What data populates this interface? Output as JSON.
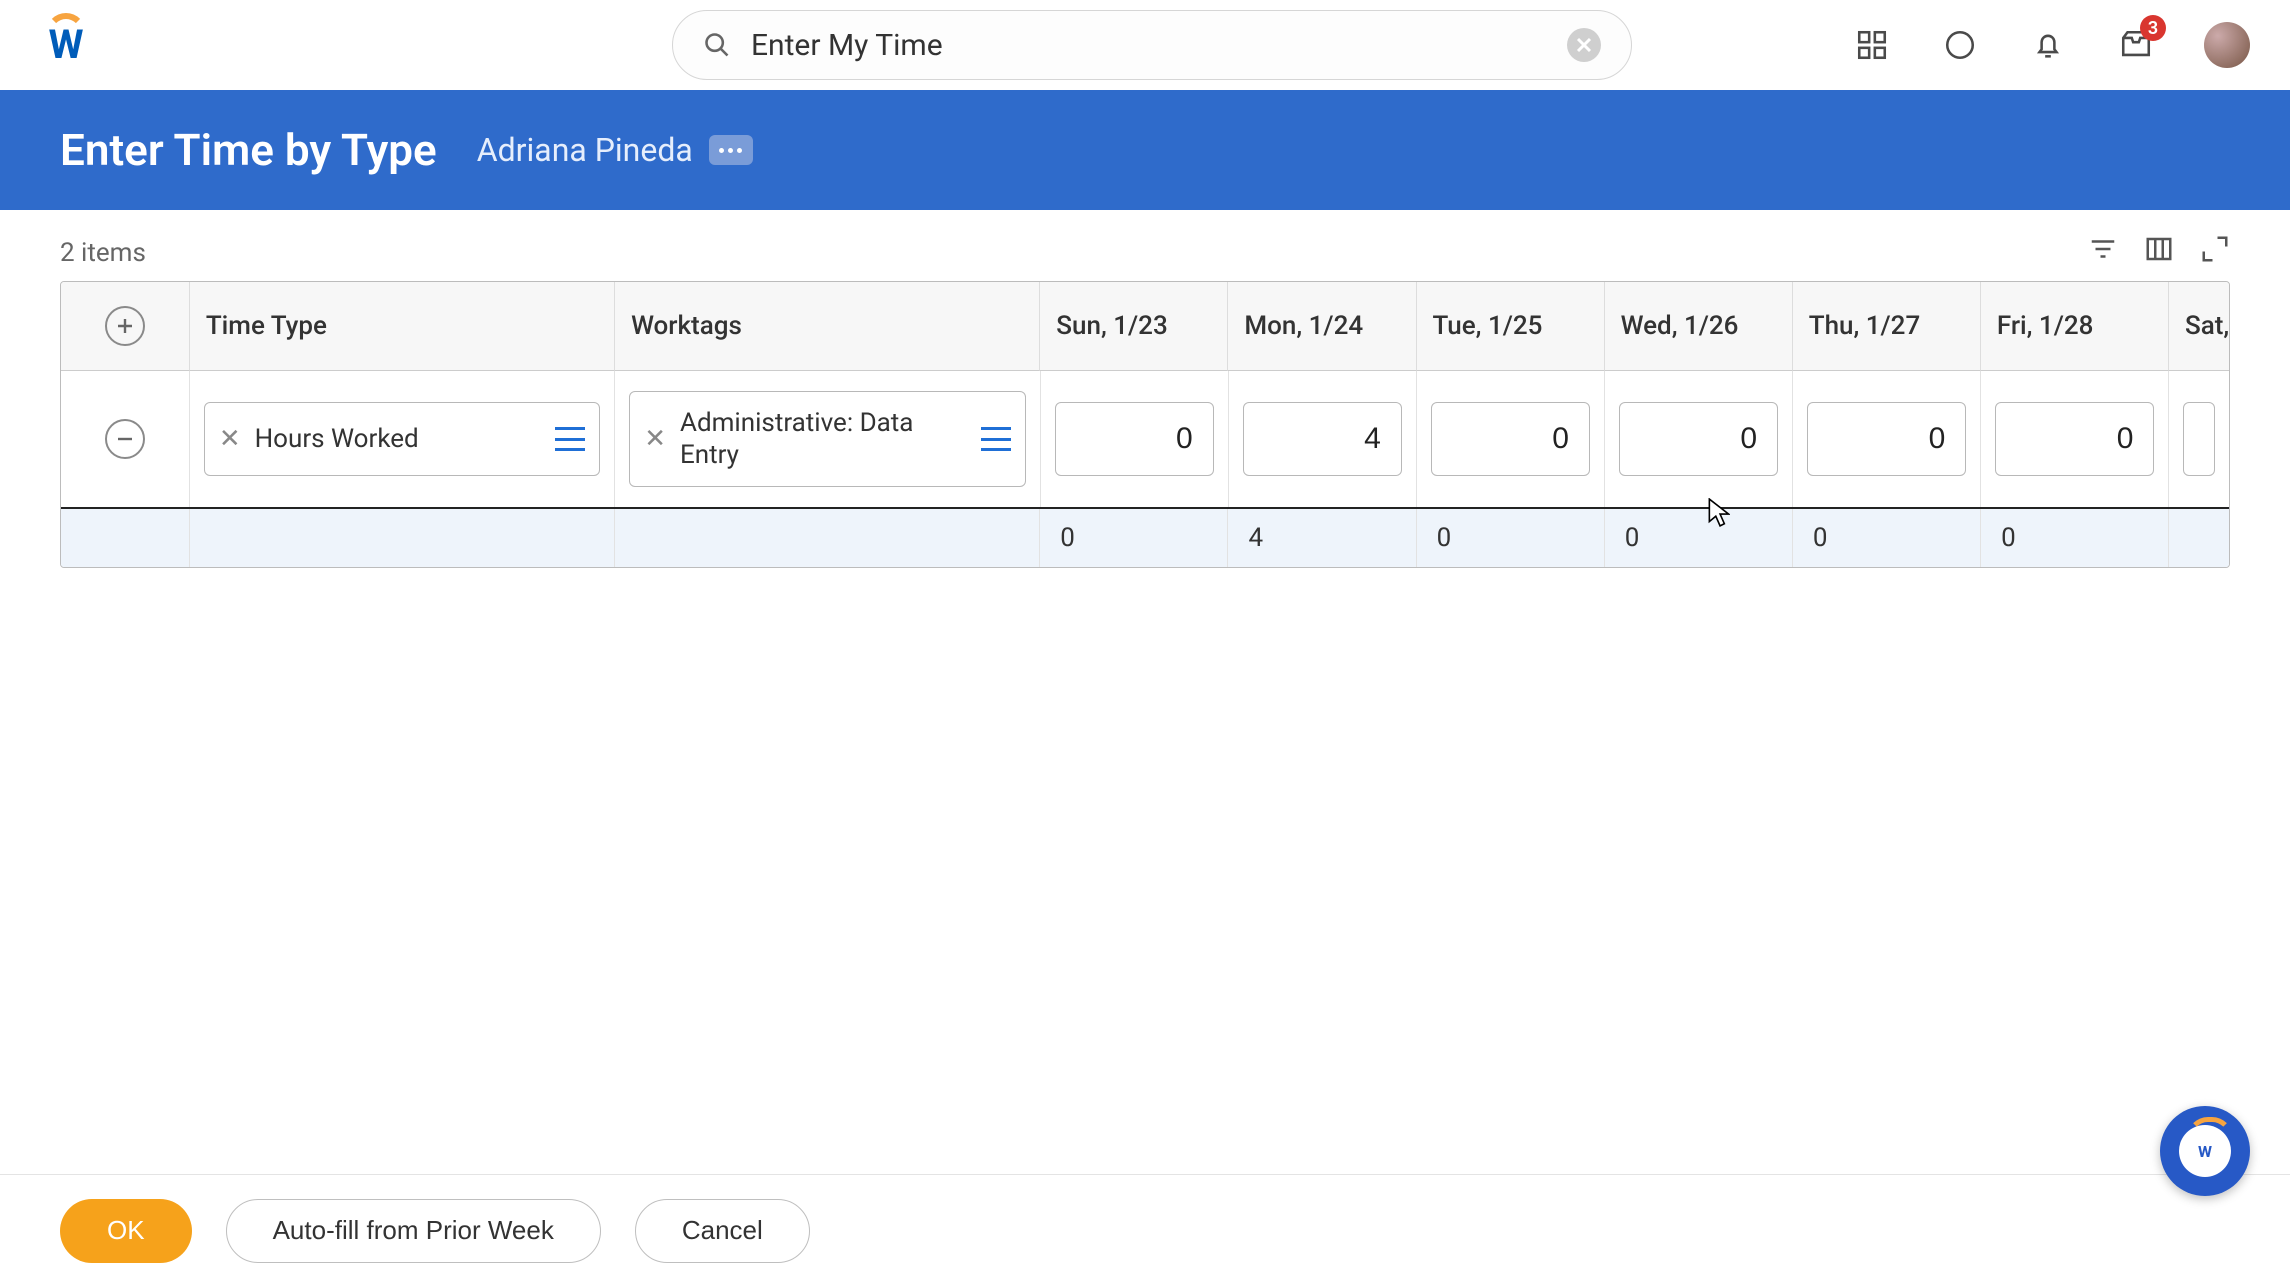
{
  "search": {
    "text": "Enter My Time"
  },
  "inbox_badge": "3",
  "header": {
    "title": "Enter Time by Type",
    "user": "Adriana Pineda"
  },
  "grid": {
    "items_label": "2 items",
    "columns": {
      "time_type": "Time Type",
      "worktags": "Worktags",
      "d0": "Sun, 1/23",
      "d1": "Mon, 1/24",
      "d2": "Tue, 1/25",
      "d3": "Wed, 1/26",
      "d4": "Thu, 1/27",
      "d5": "Fri, 1/28",
      "d6": "Sat,"
    },
    "row": {
      "time_type": "Hours Worked",
      "worktag": "Administrative: Data Entry",
      "d0": "0",
      "d1": "4",
      "d2": "0",
      "d3": "0",
      "d4": "0",
      "d5": "0"
    },
    "totals": {
      "d0": "0",
      "d1": "4",
      "d2": "0",
      "d3": "0",
      "d4": "0",
      "d5": "0"
    }
  },
  "footer": {
    "ok": "OK",
    "autofill": "Auto-fill from Prior Week",
    "cancel": "Cancel"
  }
}
